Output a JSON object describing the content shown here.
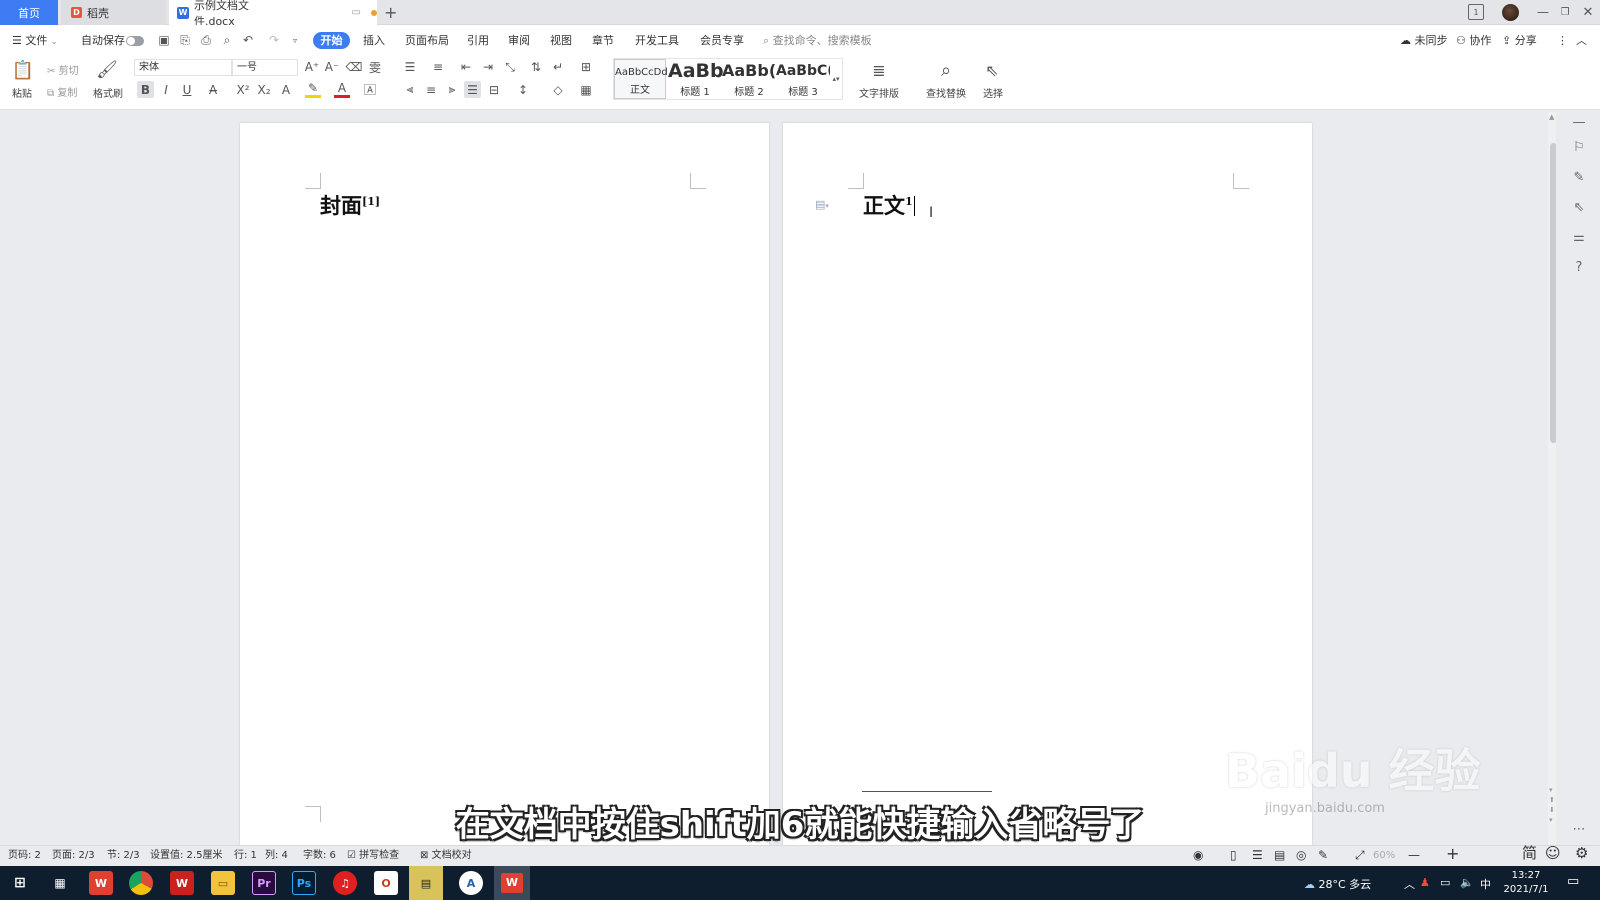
{
  "tabs": {
    "home": "首页",
    "daoke": "稻壳",
    "doc": "示例文档文件.docx",
    "new_tab": "+"
  },
  "menu": {
    "file": "文件",
    "autosave": "自动保存",
    "items": [
      "开始",
      "插入",
      "页面布局",
      "引用",
      "审阅",
      "视图",
      "章节",
      "开发工具",
      "会员专享"
    ],
    "search_placeholder": "查找命令、搜索模板",
    "sync": "未同步",
    "collab": "协作",
    "share": "分享"
  },
  "ribbon": {
    "paste": "粘贴",
    "cut": "剪切",
    "copy": "复制",
    "format_painter": "格式刷",
    "font_name": "宋体",
    "font_size": "一号",
    "styles": [
      {
        "preview": "AaBbCcDd",
        "name": "正文"
      },
      {
        "preview": "AaBb",
        "name": "标题 1"
      },
      {
        "preview": "AaBb(",
        "name": "标题 2"
      },
      {
        "preview": "AaBbC(",
        "name": "标题 3"
      }
    ],
    "text_layout": "文字排版",
    "find_replace": "查找替换",
    "select": "选择"
  },
  "document": {
    "page1_text": "封面",
    "page1_ref": "[1]",
    "page2_text": "正文",
    "page2_ref": "1"
  },
  "subtitle": "在文档中按住shift加6就能快捷输入省略号了",
  "watermark": "Baidu 经验",
  "watermark_url": "jingyan.baidu.com",
  "status": {
    "page_num": "页码: 2",
    "pages": "页面: 2/3",
    "section": "节: 2/3",
    "setting": "设置值: 2.5厘米",
    "row": "行: 1",
    "col": "列: 4",
    "words": "字数: 6",
    "spell": "拼写检查",
    "proof": "文档校对",
    "zoom": "60%"
  },
  "taskbar": {
    "weather": "28°C 多云",
    "ime": "中",
    "time": "13:27",
    "date": "2021/7/1",
    "ime_mode": "简"
  },
  "colors": {
    "accent": "#3d7cf2",
    "taskbar": "#0f1e2e"
  }
}
